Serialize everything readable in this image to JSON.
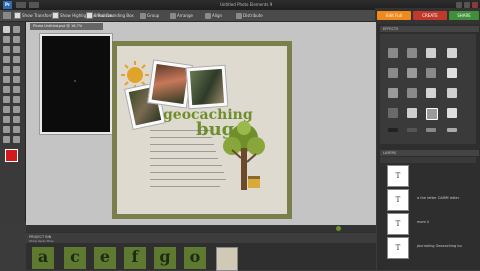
{
  "app": {
    "logo_text": "Pr",
    "title": "Untitled Photo Elements 9"
  },
  "options_bar": {
    "items": [
      "Show Transform",
      "Show Highlight on Rollover",
      "Show Bounding Box",
      "Group",
      "Arrange",
      "Align",
      "Distribute"
    ]
  },
  "mode_buttons": {
    "edit": "Edit Full",
    "create": "CREATE",
    "share": "SHARE"
  },
  "document_tab": "Photo Untitled.psd @ 16.7%",
  "scrapbook": {
    "title_line1": "geocaching",
    "title_line2": "bug",
    "journal_lines": 10
  },
  "panels": {
    "effects_header": "EFFECTS",
    "layers_header": "LAYERS",
    "layers": [
      {
        "thumb": "T",
        "label": ""
      },
      {
        "thumb": "T",
        "label": "a the letter CAMM letter"
      },
      {
        "thumb": "T",
        "label": "mom ii"
      },
      {
        "thumb": "T",
        "label": "Journaling Geocaching bu"
      }
    ]
  },
  "project_bin": {
    "header": "PROJECT BIN",
    "dropdown": "Show Open Files",
    "letters": [
      "a",
      "c",
      "e",
      "f",
      "g",
      "o"
    ]
  },
  "colors": {
    "accent": "#f08a1c",
    "create": "#c0392b",
    "share": "#3f8f3a",
    "title_green": "#6f8f2c"
  }
}
